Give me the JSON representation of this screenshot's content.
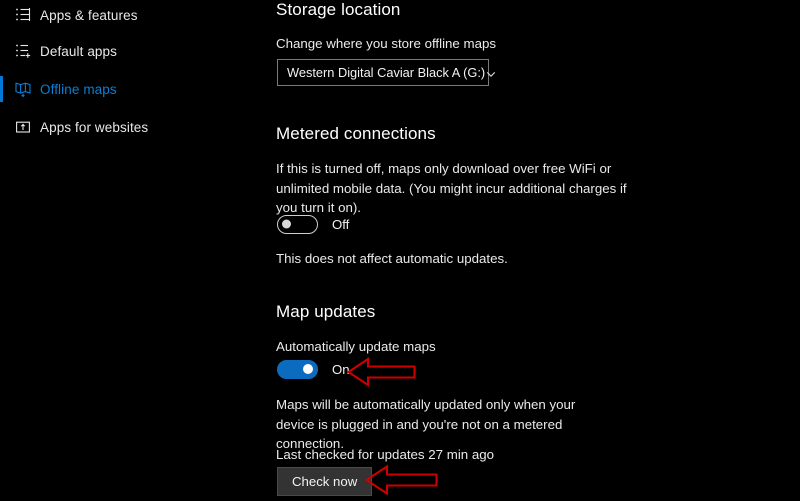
{
  "colors": {
    "background": "#000000",
    "accent_blue": "#0078d7",
    "toggle_on_blue": "#0b6cbf",
    "annotation_red": "#cc0000",
    "button_face": "#333333",
    "text_primary": "#ffffff"
  },
  "sidebar": {
    "items": [
      {
        "label": "Apps & features",
        "icon": "list-icon",
        "selected": false
      },
      {
        "label": "Default apps",
        "icon": "list-add-icon",
        "selected": false
      },
      {
        "label": "Offline maps",
        "icon": "map-book-icon",
        "selected": true
      },
      {
        "label": "Apps for websites",
        "icon": "app-link-icon",
        "selected": false
      }
    ]
  },
  "main": {
    "storage": {
      "heading": "Storage location",
      "description": "Change where you store offline maps",
      "dropdown_value": "Western Digital Caviar Black A (G:)",
      "dropdown_icon": "chevron-down-icon"
    },
    "metered": {
      "heading": "Metered connections",
      "description": "If this is turned off, maps only download over free WiFi or unlimited mobile data. (You might incur additional charges if you turn it on).",
      "toggle_state": "Off",
      "footnote": "This does not affect automatic updates."
    },
    "map_updates": {
      "heading": "Map updates",
      "auto_update_label": "Automatically update maps",
      "toggle_state": "On",
      "description": "Maps will be automatically updated only when your device is plugged in and you're not on a metered connection.",
      "last_checked": "Last checked for updates 27 min ago",
      "check_now_label": "Check now"
    }
  },
  "annotations": [
    {
      "name": "arrow-pointing-to-auto-update-toggle",
      "direction": "left"
    },
    {
      "name": "arrow-pointing-to-check-now-button",
      "direction": "left"
    }
  ]
}
